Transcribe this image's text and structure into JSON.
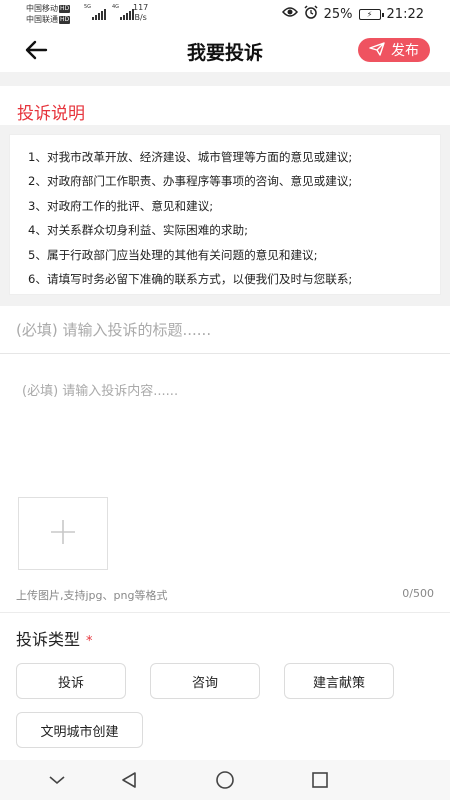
{
  "status_bar": {
    "carrier1": "中国移动",
    "carrier2": "中国联通",
    "hd": "HD",
    "net1": "5G",
    "net2": "4G",
    "speed_value": "117",
    "speed_unit": "B/s",
    "battery": "25%",
    "battery_icon_text": "⚡",
    "time": "21:22"
  },
  "nav": {
    "title": "我要投诉",
    "publish_label": "发布"
  },
  "notice": {
    "title": "投诉说明",
    "items": [
      "1、对我市改革开放、经济建设、城市管理等方面的意见或建议;",
      "2、对政府部门工作职责、办事程序等事项的咨询、意见或建议;",
      "3、对政府工作的批评、意见和建议;",
      "4、对关系群众切身利益、实际困难的求助;",
      "5、属于行政部门应当处理的其他有关问题的意见和建议;",
      "6、请填写时务必留下准确的联系方式，以便我们及时与您联系;"
    ]
  },
  "form": {
    "title_placeholder": "(必填) 请输入投诉的标题......",
    "content_placeholder": "(必填) 请输入投诉内容......",
    "upload_hint": "上传图片,支持jpg、png等格式",
    "counter": "0/500"
  },
  "type": {
    "title": "投诉类型",
    "required_mark": "*",
    "options": [
      "投诉",
      "咨询",
      "建言献策",
      "文明城市创建"
    ]
  },
  "colors": {
    "accent": "#e6343c",
    "publish_bg": "#ef5360",
    "band": "#f2f2f2"
  }
}
